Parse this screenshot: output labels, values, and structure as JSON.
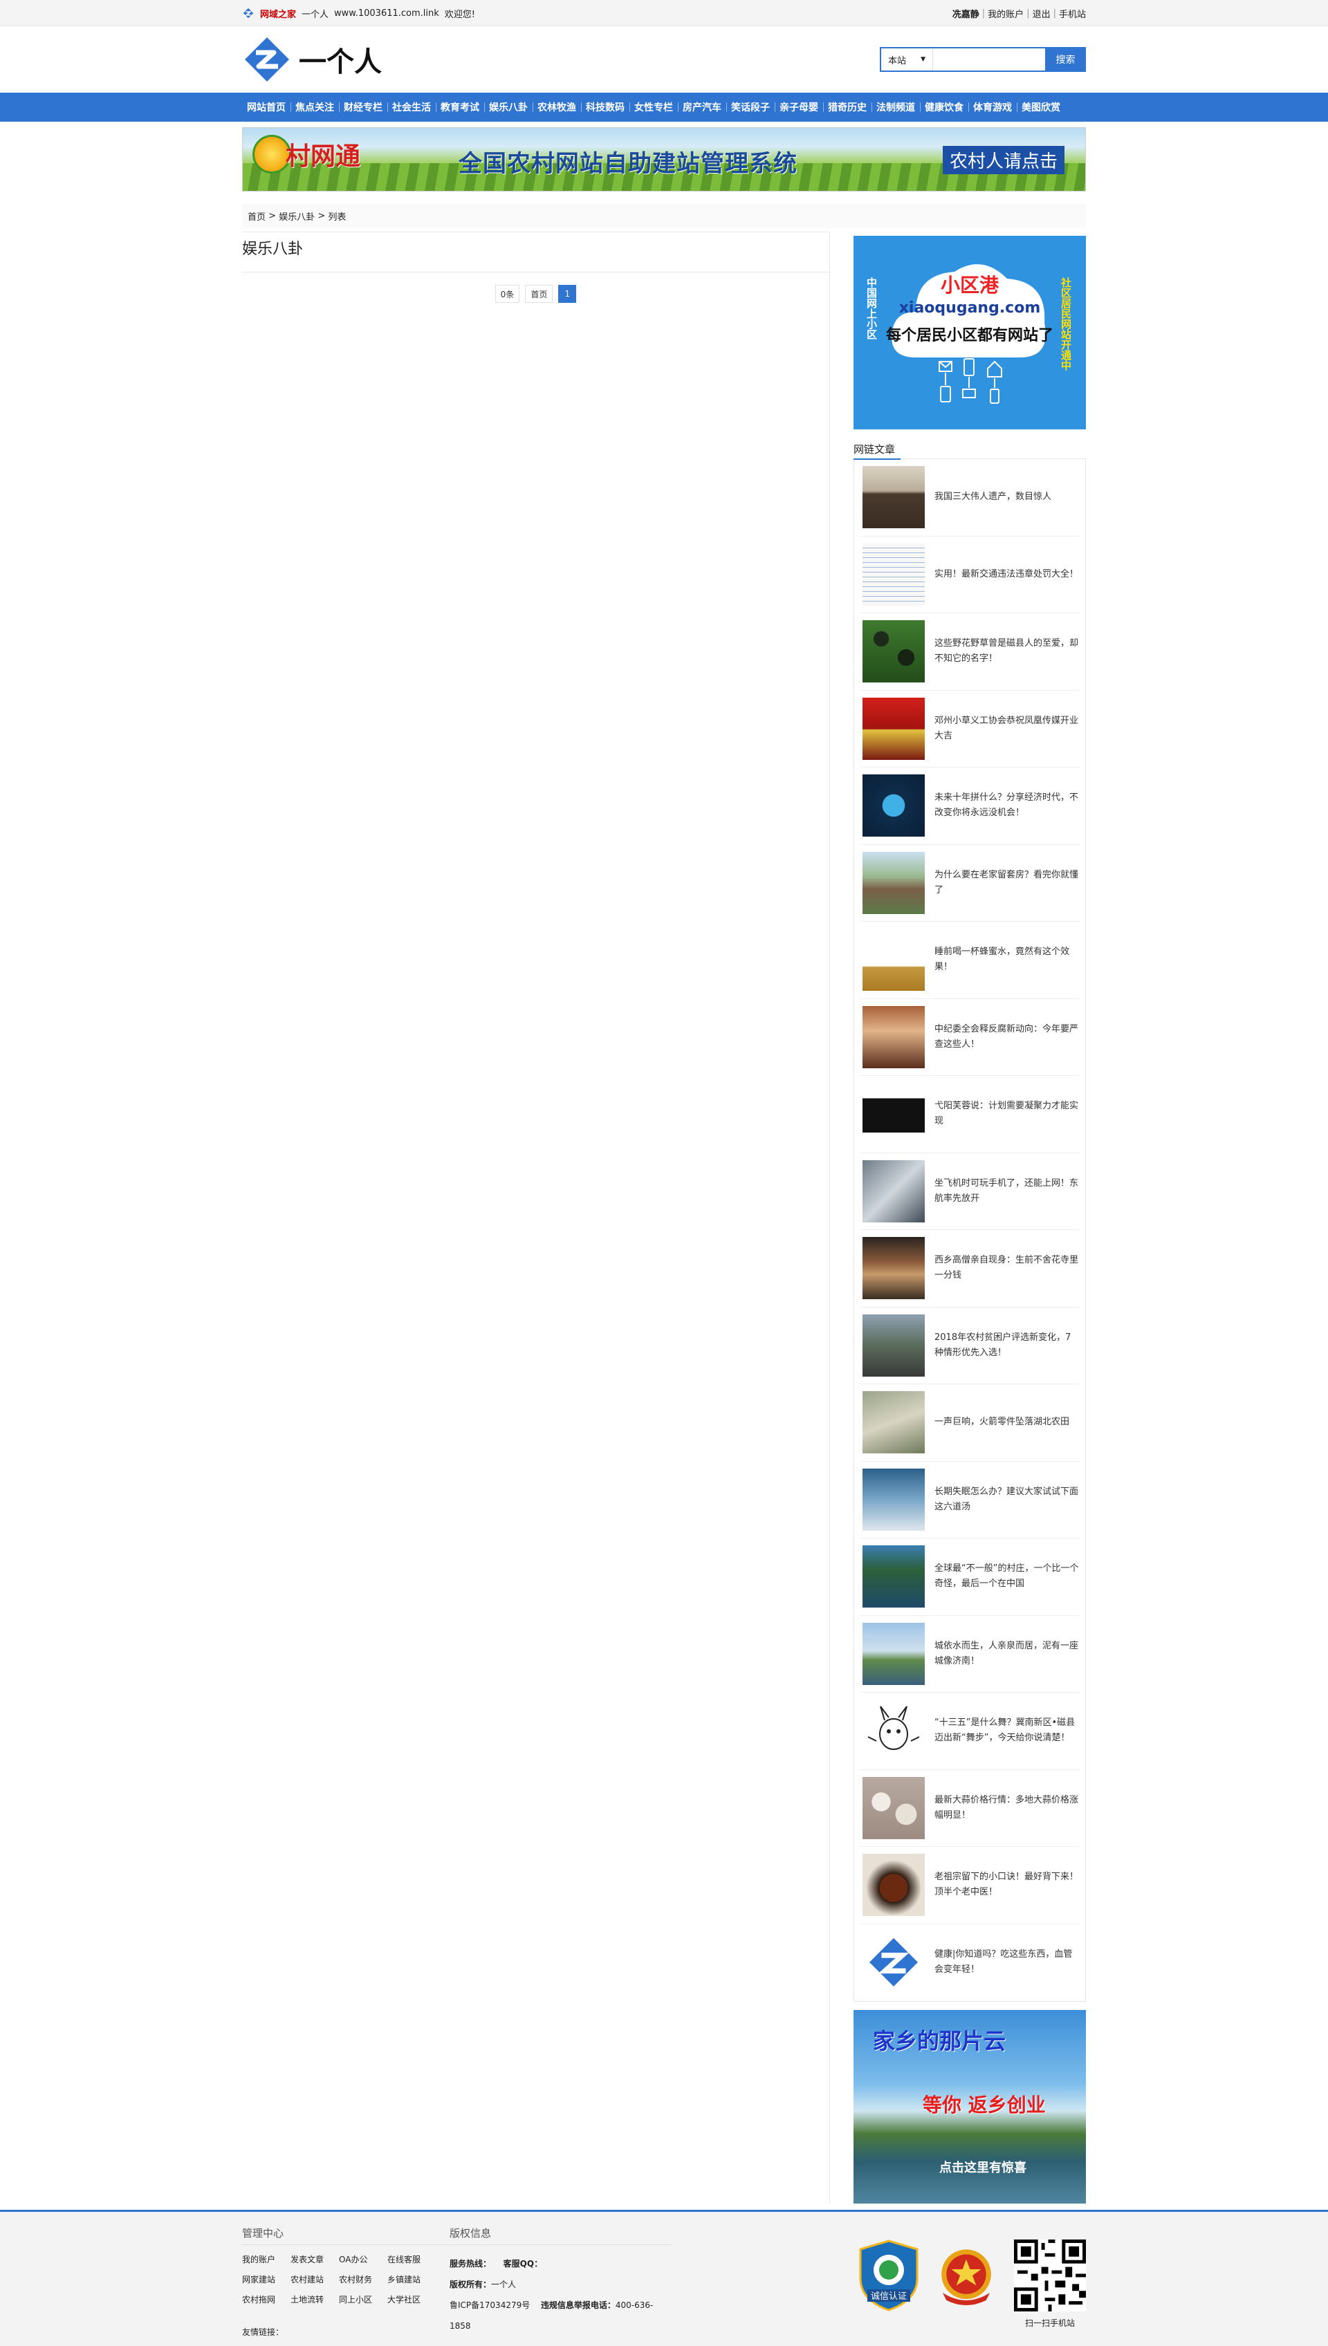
{
  "topbar": {
    "brand": "网域之家",
    "site_name": "一个人",
    "site_url": "www.1003611.com.link",
    "welcome": "欢迎您!",
    "user_name": "冼嘉静",
    "my_account": "我的账户",
    "logout": "退出",
    "mobile": "手机站"
  },
  "header": {
    "logo_text": "一个人",
    "search_scope": "本站",
    "search_button": "搜索"
  },
  "nav": [
    "网站首页",
    "焦点关注",
    "财经专栏",
    "社会生活",
    "教育考试",
    "娱乐八卦",
    "农林牧渔",
    "科技数码",
    "女性专栏",
    "房产汽车",
    "笑话段子",
    "亲子母婴",
    "猎奇历史",
    "法制频道",
    "健康饮食",
    "体育游戏",
    "美图欣赏"
  ],
  "banner": {
    "brand": "村网通",
    "title": "全国农村网站自助建站管理系统",
    "button": "农村人请点击"
  },
  "breadcrumb": {
    "home": "首页",
    "sep1": " > ",
    "category": "娱乐八卦",
    "sep2": " > ",
    "current": "列表"
  },
  "main": {
    "title": "娱乐八卦",
    "pager": {
      "count": "0条",
      "first": "首页",
      "current": "1"
    }
  },
  "side_ad": {
    "title": "小区港",
    "domain": "xiaoqugang.com",
    "slogan": "每个居民小区都有网站了",
    "left_vertical": "中国网上小区",
    "right_vertical": "社区居民网站开通中"
  },
  "side_list": {
    "heading": "网链文章",
    "items": [
      {
        "text": "我国三大伟人遗产，数目惊人",
        "thumb": "portrait"
      },
      {
        "text": "实用！最新交通违法违章处罚大全！",
        "thumb": "table"
      },
      {
        "text": "这些野花野草曾是磁县人的至爱，却不知它的名字！",
        "thumb": "berries"
      },
      {
        "text": "邓州小草义工协会恭祝凤凰传媒开业大吉",
        "thumb": "red-event"
      },
      {
        "text": "未来十年拼什么？分享经济时代，不改变你将永远没机会！",
        "thumb": "globe"
      },
      {
        "text": "为什么要在老家留套房？看完你就懂了",
        "thumb": "village"
      },
      {
        "text": "睡前喝一杯蜂蜜水，竟然有这个效果！",
        "thumb": "honey"
      },
      {
        "text": "中纪委全会释反腐新动向：今年要严查这些人！",
        "thumb": "meeting"
      },
      {
        "text": "弋阳芙蓉说：计划需要凝聚力才能实现",
        "thumb": "screen"
      },
      {
        "text": "坐飞机时可玩手机了，还能上网！东航率先放开",
        "thumb": "phone"
      },
      {
        "text": "西乡高僧亲自现身：生前不舍花寺里一分钱",
        "thumb": "monks"
      },
      {
        "text": "2018年农村贫困户评选新变化，7种情形优先入选！",
        "thumb": "villagers"
      },
      {
        "text": "一声巨响，火箭零件坠落湖北农田",
        "thumb": "debris"
      },
      {
        "text": "长期失眠怎么办？建议大家试试下面这六道汤",
        "thumb": "sleep"
      },
      {
        "text": "全球最“不一般”的村庄，一个比一个奇怪，最后一个在中国",
        "thumb": "island"
      },
      {
        "text": "城依水而生，人亲泉而居，泥有一座城像济南！",
        "thumb": "city"
      },
      {
        "text": "“十三五”是什么舞？冀南新区•磁县迈出新“舞步”，今天给你说清楚！",
        "thumb": "cartoon"
      },
      {
        "text": "最新大蒜价格行情：多地大蒜价格涨幅明显！",
        "thumb": "garlic"
      },
      {
        "text": "老祖宗留下的小口诀！最好背下来！顶半个老中医！",
        "thumb": "food"
      },
      {
        "text": "健康|你知道吗？吃这些东西，血管会变年轻！",
        "thumb": "logo"
      }
    ]
  },
  "side_ad2": {
    "line1": "家乡的那片云",
    "line2": "等你 返乡创业",
    "line3": "点击这里有惊喜"
  },
  "footer": {
    "col1_title": "管理中心",
    "links": [
      "我的账户",
      "发表文章",
      "OA办公",
      "在线客服",
      "网家建站",
      "农村建站",
      "农村财务",
      "乡镇建站",
      "农村拖网",
      "土地流转",
      "同上小区",
      "大学社区"
    ],
    "col2_title": "版权信息",
    "service_label": "服务热线：",
    "qq_label": "客服QQ：",
    "owner_label": "版权所有：",
    "owner": "一个人",
    "icp": "鲁ICP备17034279号",
    "report_label": "违规信息举报电话：",
    "report_phone": "400-636-1858",
    "friend_links": "友情链接：",
    "badge1": "诚信认证",
    "qr_caption": "扫一扫手机站"
  },
  "colors": {
    "primary": "#2f74d0",
    "brand_red": "#cc0000"
  }
}
